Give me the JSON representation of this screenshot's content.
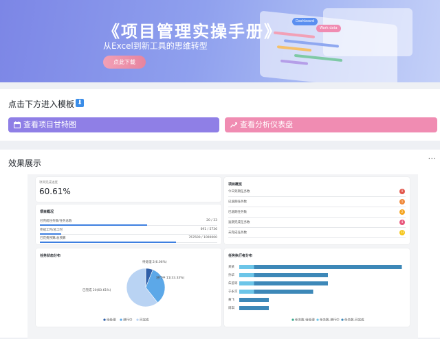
{
  "banner": {
    "title": "《项目管理实操手册》",
    "subtitle": "从Excel到新工具的思维转型",
    "download_label": "点此下载",
    "mock_tags": [
      "Dashboard",
      "Work data"
    ]
  },
  "templates": {
    "title": "点击下方进入模板",
    "gantt_label": "查看项目甘特图",
    "analytics_label": "查看分析仪表盘"
  },
  "showcase": {
    "title": "效果展示",
    "more": "···"
  },
  "dashboard": {
    "progress": {
      "label": "项目完成进度",
      "value": "60.61%"
    },
    "overview_left": {
      "title": "项目概况",
      "rows": [
        {
          "label": "已完成任务数/任务总数",
          "value": "20",
          "total": "33",
          "fraction": 0.606
        },
        {
          "label": "完成工时/总工时",
          "value": "691",
          "total": "5736",
          "fraction": 0.12
        },
        {
          "label": "已花费预算/总预算",
          "value": "767600",
          "total": "1000000",
          "fraction": 0.7676
        }
      ]
    },
    "overview_right": {
      "title": "项目概览",
      "rows": [
        {
          "label": "今日到期任务数",
          "count": "0",
          "color": "#e2574c"
        },
        {
          "label": "已逾期任务数",
          "count": "1",
          "color": "#f08a3c"
        },
        {
          "label": "已逾期任务数",
          "count": "2",
          "color": "#f5a623"
        },
        {
          "label": "逾期完成任务数",
          "count": "4",
          "color": "#e8577c"
        },
        {
          "label": "未完成任务数",
          "count": "13",
          "color": "#f5c518"
        }
      ]
    },
    "status_chart": {
      "title": "任务状态分布",
      "legend": [
        "待处理",
        "进行中",
        "已完成"
      ],
      "labels": [
        "待处理 2(6.06%)",
        "进行中 11(33.33%)",
        "已完成 20(60.61%)"
      ]
    },
    "executor_chart": {
      "title": "任务执行者分布",
      "people": [
        "某某",
        "孙华",
        "朱茵等",
        "于永京",
        "黄飞",
        "周琪"
      ],
      "legend": [
        "任务数-待处理",
        "任务数-进行中",
        "任务数-已完成"
      ]
    }
  },
  "chart_data": [
    {
      "type": "pie",
      "title": "任务状态分布",
      "categories": [
        "待处理",
        "进行中",
        "已完成"
      ],
      "values": [
        2,
        11,
        20
      ],
      "colors": [
        "#2f5fa8",
        "#5ca8e8",
        "#b9d3f3"
      ]
    },
    {
      "type": "bar",
      "orientation": "horizontal",
      "stacked": true,
      "title": "任务执行者分布",
      "categories": [
        "某某",
        "孙华",
        "朱茵等",
        "于永京",
        "黄飞",
        "周琪"
      ],
      "series": [
        {
          "name": "任务数-待处理",
          "values": [
            0,
            0,
            0,
            0,
            0,
            0
          ]
        },
        {
          "name": "任务数-进行中",
          "values": [
            1,
            1,
            1,
            1,
            0,
            0
          ]
        },
        {
          "name": "任务数-已完成",
          "values": [
            10,
            5,
            5,
            4,
            2,
            2
          ]
        }
      ],
      "colors": [
        "#3aa98d",
        "#6cc5e8",
        "#3d88b8"
      ],
      "legend_position": "bottom"
    }
  ]
}
